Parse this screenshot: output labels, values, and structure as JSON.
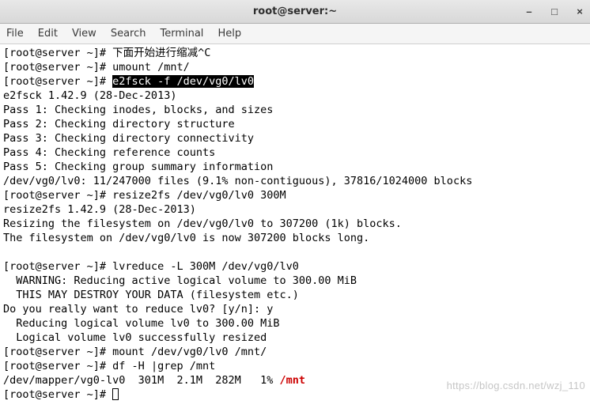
{
  "window": {
    "title": "root@server:~",
    "controls": {
      "min": "–",
      "max": "□",
      "close": "×"
    }
  },
  "menu": {
    "file": "File",
    "edit": "Edit",
    "view": "View",
    "search": "Search",
    "terminal": "Terminal",
    "help": "Help"
  },
  "terminal": {
    "l1_prompt": "[root@server ~]# ",
    "l1_cmd": "下面开始进行缩减^C",
    "l2_prompt": "[root@server ~]# ",
    "l2_cmd": "umount /mnt/",
    "l3_prompt": "[root@server ~]# ",
    "l3_cmd": "e2fsck -f /dev/vg0/lv0",
    "l4": "e2fsck 1.42.9 (28-Dec-2013)",
    "l5": "Pass 1: Checking inodes, blocks, and sizes",
    "l6": "Pass 2: Checking directory structure",
    "l7": "Pass 3: Checking directory connectivity",
    "l8": "Pass 4: Checking reference counts",
    "l9": "Pass 5: Checking group summary information",
    "l10": "/dev/vg0/lv0: 11/247000 files (9.1% non-contiguous), 37816/1024000 blocks",
    "l11_prompt": "[root@server ~]# ",
    "l11_cmd": "resize2fs /dev/vg0/lv0 300M",
    "l12": "resize2fs 1.42.9 (28-Dec-2013)",
    "l13": "Resizing the filesystem on /dev/vg0/lv0 to 307200 (1k) blocks.",
    "l14": "The filesystem on /dev/vg0/lv0 is now 307200 blocks long.",
    "l15": "",
    "l16_prompt": "[root@server ~]# ",
    "l16_cmd": "lvreduce -L 300M /dev/vg0/lv0",
    "l17": "  WARNING: Reducing active logical volume to 300.00 MiB",
    "l18": "  THIS MAY DESTROY YOUR DATA (filesystem etc.)",
    "l19": "Do you really want to reduce lv0? [y/n]: y",
    "l20": "  Reducing logical volume lv0 to 300.00 MiB",
    "l21": "  Logical volume lv0 successfully resized",
    "l22_prompt": "[root@server ~]# ",
    "l22_cmd": "mount /dev/vg0/lv0 /mnt/",
    "l23_prompt": "[root@server ~]# ",
    "l23_cmd": "df -H |grep /mnt",
    "l24_a": "/dev/mapper/vg0-lv0  301M  2.1M  282M   1% ",
    "l24_b": "/mnt",
    "l25_prompt": "[root@server ~]# "
  },
  "watermark": "https://blog.csdn.net/wzj_110"
}
